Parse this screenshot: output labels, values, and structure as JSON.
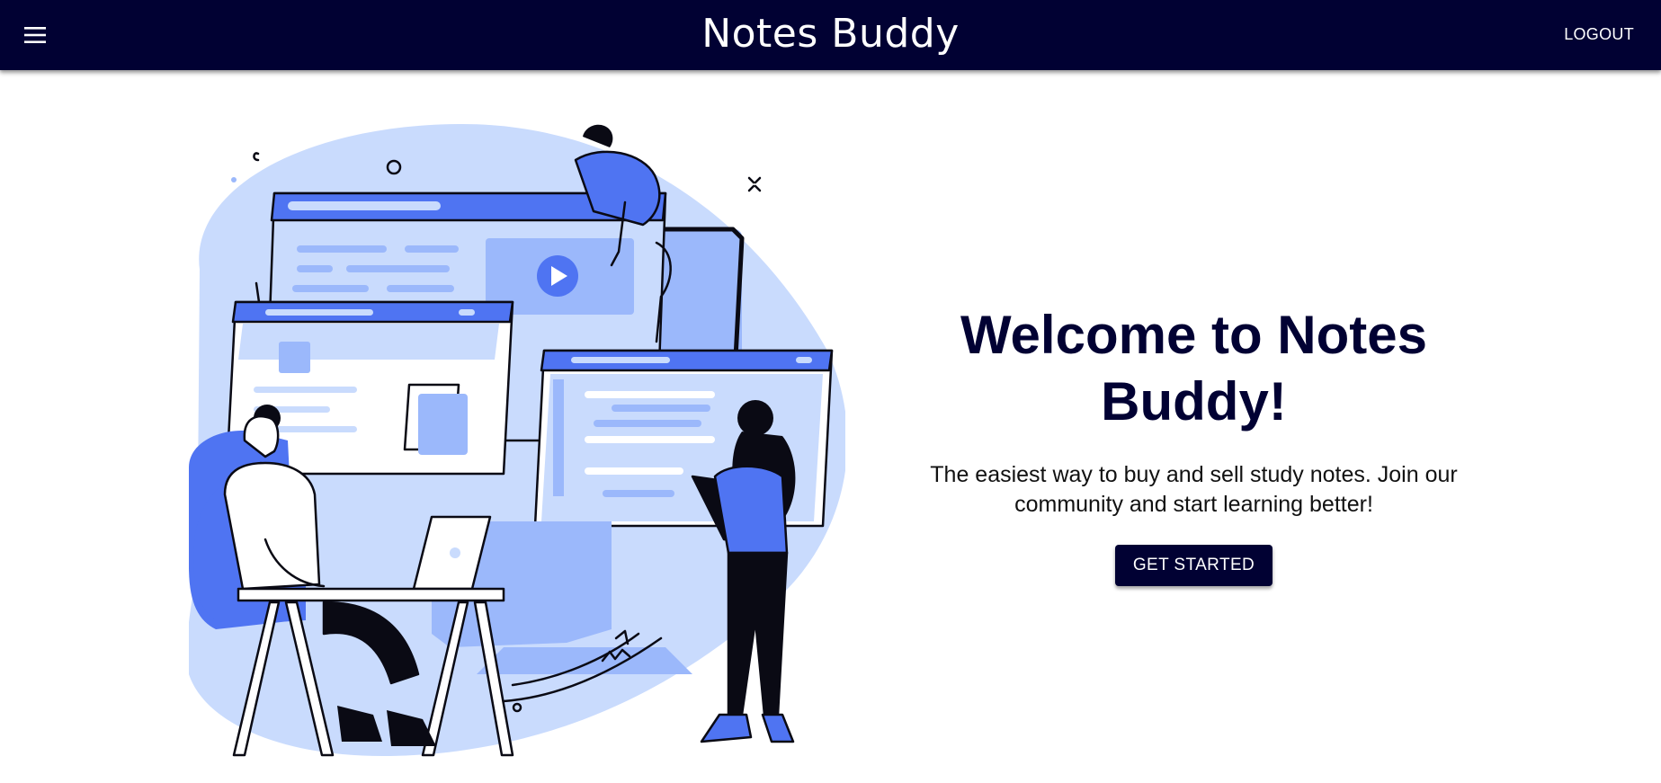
{
  "header": {
    "title": "Notes Buddy",
    "menu_icon": "hamburger-menu-icon",
    "logout_label": "LOGOUT"
  },
  "hero": {
    "heading": "Welcome to Notes Buddy!",
    "subtitle": "The easiest way to buy and sell study notes. Join our community and start learning better!",
    "cta_label": "GET STARTED"
  },
  "colors": {
    "navy": "#010133",
    "accent_blue": "#4f74f2",
    "light_blue": "#c9dbfd",
    "mid_blue": "#9bb8fb",
    "white": "#ffffff"
  }
}
